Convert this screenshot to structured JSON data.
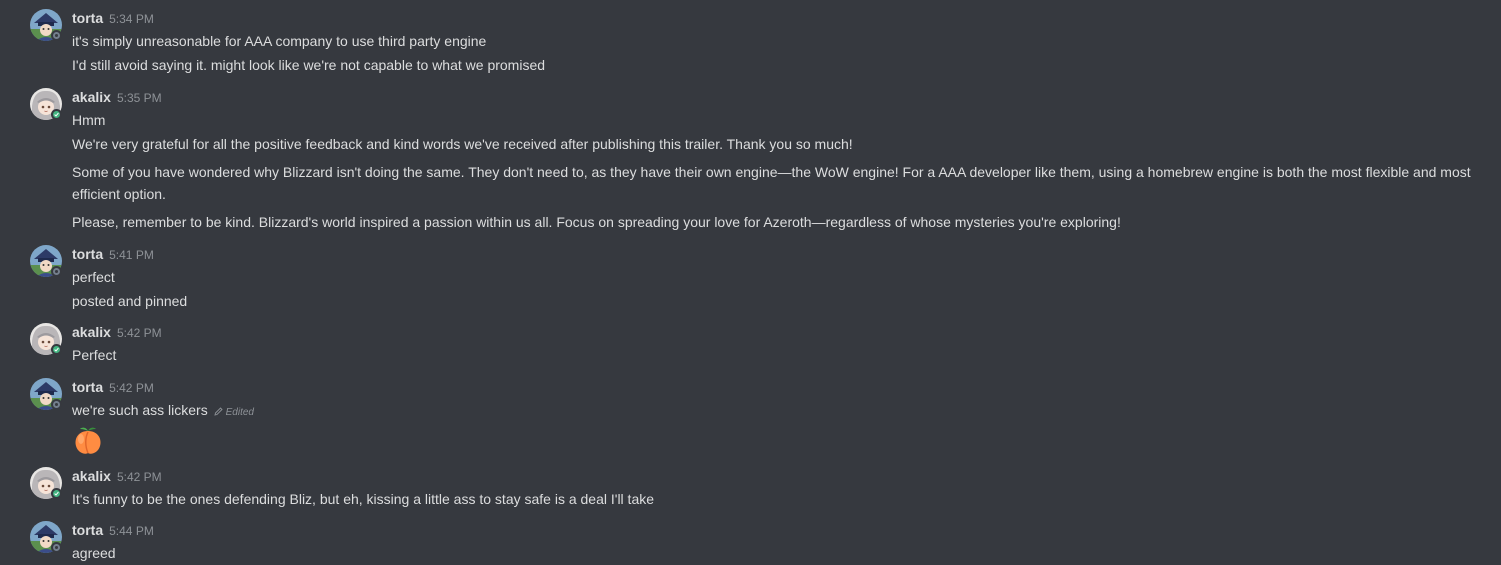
{
  "colors": {
    "background": "#36393f",
    "text": "#dcddde",
    "muted": "#8e9297",
    "online": "#43b581",
    "offline": "#747f8d"
  },
  "messages": [
    {
      "author": "torta",
      "time": "5:34 PM",
      "status": "offline",
      "lines": [
        "it's simply unreasonable for AAA company to use third party engine",
        "I'd still avoid saying it. might look like we're not capable to what we promised"
      ]
    },
    {
      "author": "akalix",
      "time": "5:35 PM",
      "status": "online",
      "lines": [
        "Hmm",
        "We're very grateful for all the positive feedback and kind words we've received after publishing this trailer. Thank you so much!",
        "Some of you have wondered why Blizzard isn't doing the same. They don't need to, as they have their own engine—the WoW engine! For a AAA developer like them, using a homebrew engine is both the most flexible and most efficient option.",
        "Please, remember to be kind. Blizzard's world inspired a passion within us all. Focus on spreading your love for Azeroth—regardless of whose mysteries you're exploring!"
      ]
    },
    {
      "author": "torta",
      "time": "5:41 PM",
      "status": "offline",
      "lines": [
        "perfect",
        "posted and pinned"
      ]
    },
    {
      "author": "akalix",
      "time": "5:42 PM",
      "status": "online",
      "lines": [
        "Perfect"
      ]
    },
    {
      "author": "torta",
      "time": "5:42 PM",
      "status": "offline",
      "lines": [
        "we're such ass lickers"
      ],
      "edited_label": "Edited",
      "emoji": "peach-emoji"
    },
    {
      "author": "akalix",
      "time": "5:42 PM",
      "status": "online",
      "lines": [
        "It's funny to be the ones defending Bliz, but eh, kissing a little ass to stay safe is a deal I'll take"
      ]
    },
    {
      "author": "torta",
      "time": "5:44 PM",
      "status": "offline",
      "lines": [
        "agreed"
      ]
    }
  ]
}
